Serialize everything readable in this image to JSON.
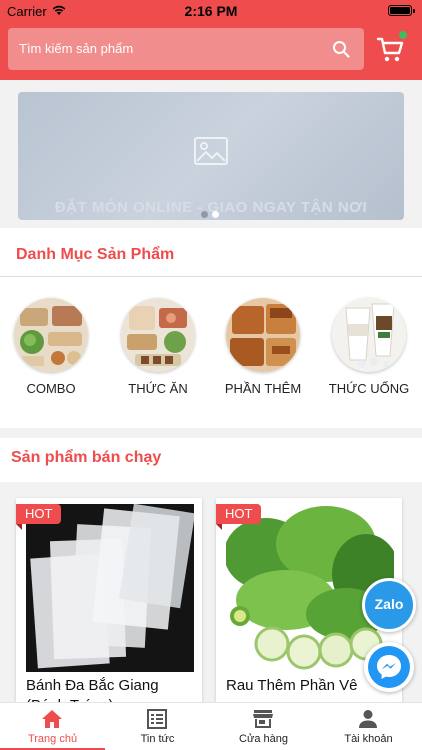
{
  "status_bar": {
    "carrier": "Carrier",
    "time": "2:16 PM"
  },
  "search": {
    "placeholder": "Tìm kiếm sản phẩm"
  },
  "icons": {
    "search": "search-icon",
    "cart": "cart-icon",
    "banner_placeholder": "image-icon",
    "home": "home-icon",
    "news": "news-icon",
    "store": "store-icon",
    "account": "person-icon",
    "zalo": "zalo-icon",
    "messenger": "messenger-icon"
  },
  "colors": {
    "brand": "#ef4d4d",
    "cart_badge": "#3dbd5d",
    "zalo": "#2a9ae8",
    "messenger": "#2196f3"
  },
  "banner": {
    "tagline": "ĐẶT MÓN ONLINE - GIAO NGAY TẬN NƠI",
    "slide_count": 2,
    "active_slide": 2
  },
  "categories": {
    "title": "Danh Mục Sản Phẩm",
    "items": [
      {
        "label": "COMBO"
      },
      {
        "label": "THỨC ĂN"
      },
      {
        "label": "PHẦN THÊM"
      },
      {
        "label": "THỨC UỐNG"
      }
    ]
  },
  "best_sellers": {
    "title": "Sản phẩm bán chạy",
    "products": [
      {
        "badge": "HOT",
        "name": "Bánh Đa Bắc Giang (Bánh Tráng)"
      },
      {
        "badge": "HOT",
        "name": "Rau Thêm Phần Vê"
      }
    ]
  },
  "chat": {
    "zalo_label": "Zalo"
  },
  "bottom_nav": {
    "items": [
      {
        "label": "Trang chủ",
        "active": true
      },
      {
        "label": "Tin tức"
      },
      {
        "label": "Cửa hàng"
      },
      {
        "label": "Tài khoản"
      }
    ]
  }
}
